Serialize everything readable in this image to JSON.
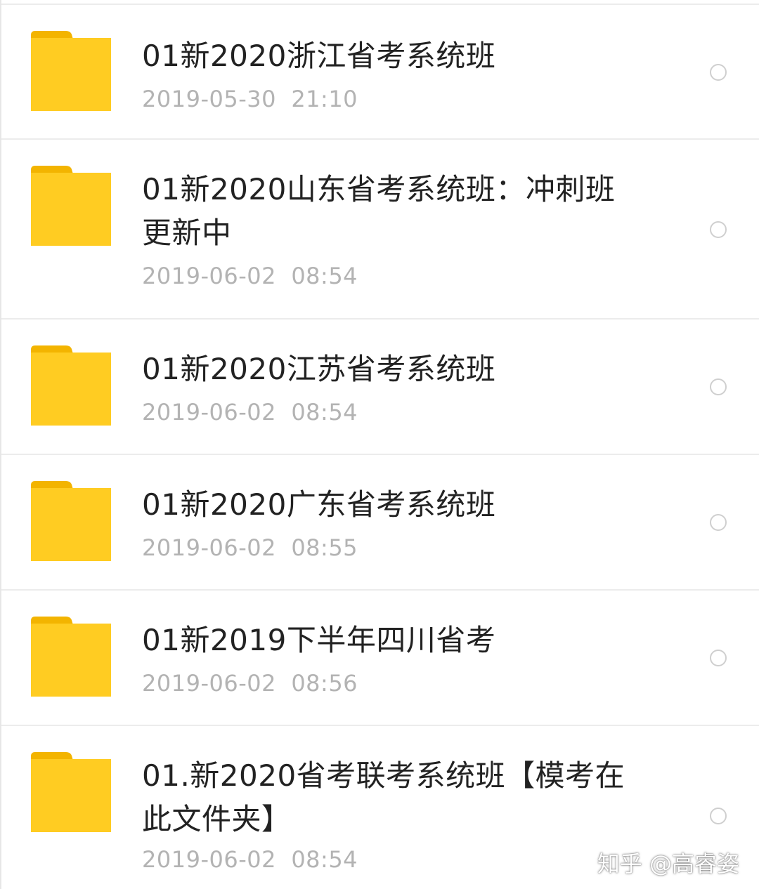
{
  "items": [
    {
      "name": "01新2020浙江省考系统班",
      "date": "2019-05-30  21:10"
    },
    {
      "name": "01新2020山东省考系统班：冲刺班更新中",
      "date": "2019-06-02  08:54"
    },
    {
      "name": "01新2020江苏省考系统班",
      "date": "2019-06-02  08:54"
    },
    {
      "name": "01新2020广东省考系统班",
      "date": "2019-06-02  08:55"
    },
    {
      "name": "01新2019下半年四川省考",
      "date": "2019-06-02  08:56"
    },
    {
      "name": "01.新2020省考联考系统班【模考在此文件夹】",
      "date": "2019-06-02  08:54"
    }
  ],
  "watermark": "知乎 @高睿姿",
  "colors": {
    "folder": "#FFCC22",
    "folder_tab": "#F3B400",
    "title_text": "#222222",
    "date_text": "#B3B3B3",
    "divider": "#ECECEC"
  },
  "icons": {
    "folder": "folder-icon",
    "select": "radio-circle-icon"
  }
}
